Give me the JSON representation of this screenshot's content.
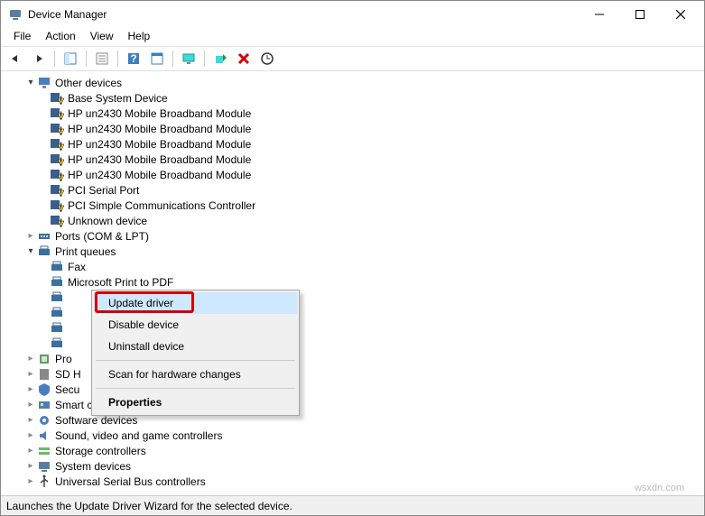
{
  "window": {
    "title": "Device Manager",
    "minimize_tip": "Minimize",
    "maximize_tip": "Maximize",
    "close_tip": "Close"
  },
  "menu": {
    "file": "File",
    "action": "Action",
    "view": "View",
    "help": "Help"
  },
  "toolbar": {
    "back": "Back",
    "forward": "Forward",
    "show_hide": "Show/Hide Console Tree",
    "properties": "Properties",
    "help": "Help",
    "options": "Options",
    "monitors": "Show hidden devices",
    "scan": "Scan for hardware changes",
    "uninstall": "Uninstall device",
    "update": "Update device drivers"
  },
  "tree": {
    "other_devices": "Other devices",
    "base_system_device": "Base System Device",
    "hp_broadband": "HP un2430 Mobile Broadband Module",
    "pci_serial": "PCI Serial Port",
    "pci_comm": "PCI Simple Communications Controller",
    "unknown_device": "Unknown device",
    "ports": "Ports (COM & LPT)",
    "print_queues": "Print queues",
    "fax": "Fax",
    "ms_print_pdf": "Microsoft Print to PDF",
    "processors_trunc": "Pro",
    "sd_host_trunc": "SD H",
    "security_trunc": "Secu",
    "smart_card": "Smart card readers",
    "software": "Software devices",
    "sound": "Sound, video and game controllers",
    "storage": "Storage controllers",
    "system": "System devices",
    "usb_trunc": "Universal Serial Bus controllers"
  },
  "context_menu": {
    "update_driver": "Update driver",
    "disable_device": "Disable device",
    "uninstall_device": "Uninstall device",
    "scan_changes": "Scan for hardware changes",
    "properties": "Properties"
  },
  "statusbar": {
    "text": "Launches the Update Driver Wizard for the selected device."
  },
  "watermark": "wsxdn.com"
}
